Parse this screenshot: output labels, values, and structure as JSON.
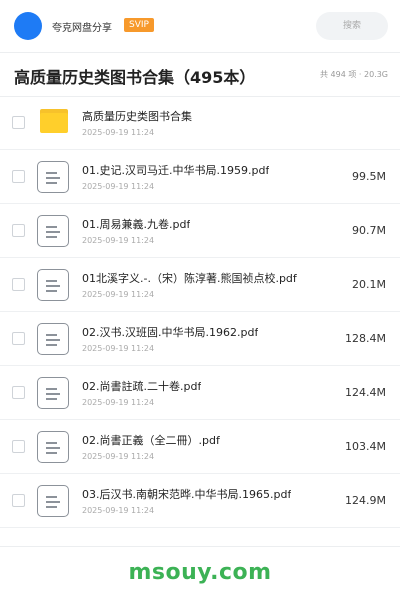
{
  "header": {
    "app_name": "夸克网盘分享",
    "badge": "SVIP",
    "search_placeholder": "搜索"
  },
  "share": {
    "title": "高质量历史类图书合集（495本）",
    "summary": "共 494 项 · 20.3G"
  },
  "items": [
    {
      "type": "folder",
      "icon": "folder-icon",
      "name": "高质量历史类图书合集",
      "date": "2025-09-19 11:24",
      "size": ""
    },
    {
      "type": "file",
      "icon": "file-icon",
      "name": "01.史记.汉司马迁.中华书局.1959.pdf",
      "date": "2025-09-19 11:24",
      "size": "99.5M"
    },
    {
      "type": "file",
      "icon": "file-icon",
      "name": "01.周易兼義.九卷.pdf",
      "date": "2025-09-19 11:24",
      "size": "90.7M"
    },
    {
      "type": "file",
      "icon": "file-icon",
      "name": "01北溪字义.-.（宋）陈淳著.熊国祯点校.pdf",
      "date": "2025-09-19 11:24",
      "size": "20.1M"
    },
    {
      "type": "file",
      "icon": "file-icon",
      "name": "02.汉书.汉班固.中华书局.1962.pdf",
      "date": "2025-09-19 11:24",
      "size": "128.4M"
    },
    {
      "type": "file",
      "icon": "file-icon",
      "name": "02.尚書註疏.二十卷.pdf",
      "date": "2025-09-19 11:24",
      "size": "124.4M"
    },
    {
      "type": "file",
      "icon": "file-icon",
      "name": "02.尚書正義（全二冊）.pdf",
      "date": "2025-09-19 11:24",
      "size": "103.4M"
    },
    {
      "type": "file",
      "icon": "file-icon",
      "name": "03.后汉书.南朝宋范晔.中华书局.1965.pdf",
      "date": "2025-09-19 11:24",
      "size": "124.9M"
    }
  ],
  "watermark": "msouy.com",
  "colors": {
    "avatar": "#1e7bf5",
    "svip": "#f7992b",
    "folder": "#ffcf2b",
    "watermark": "#3cb255"
  }
}
